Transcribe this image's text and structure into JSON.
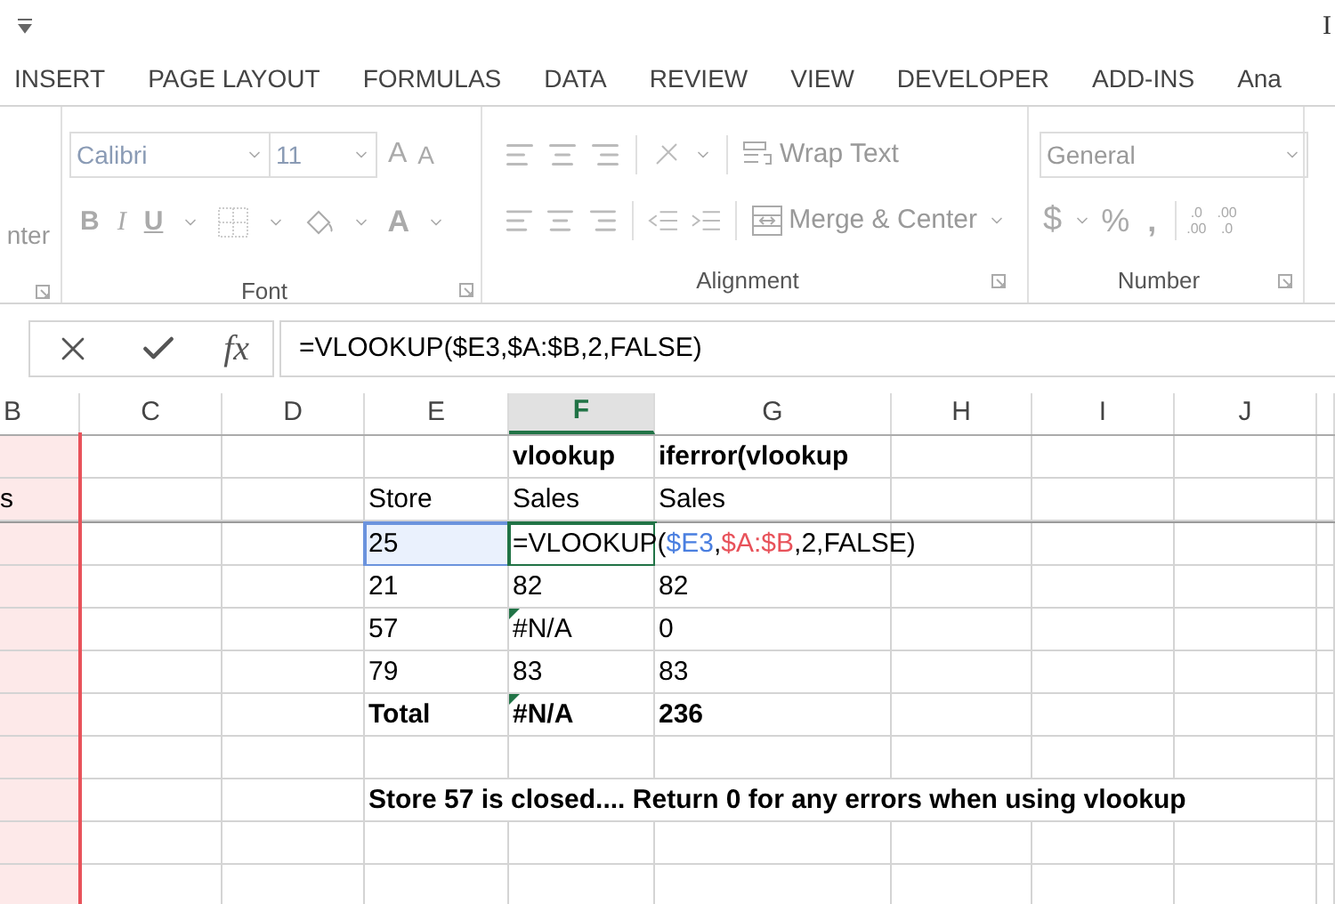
{
  "title_bar": {
    "title_fragment": "I"
  },
  "ribbon_tabs": [
    {
      "label": "INSERT",
      "selected": false
    },
    {
      "label": "PAGE LAYOUT",
      "selected": false
    },
    {
      "label": "FORMULAS",
      "selected": false
    },
    {
      "label": "DATA",
      "selected": false
    },
    {
      "label": "REVIEW",
      "selected": false
    },
    {
      "label": "VIEW",
      "selected": false
    },
    {
      "label": "DEVELOPER",
      "selected": false
    },
    {
      "label": "ADD-INS",
      "selected": false
    },
    {
      "label": "Ana",
      "selected": false
    }
  ],
  "ribbon": {
    "left_fragment": "nter",
    "font": {
      "name": "Calibri",
      "size": "11",
      "grow": "A",
      "shrink": "A",
      "bold": "B",
      "italic": "I",
      "underline": "U",
      "font_color": "A",
      "label": "Font"
    },
    "alignment": {
      "wrap_text": "Wrap Text",
      "merge_center": "Merge & Center",
      "label": "Alignment"
    },
    "number": {
      "format": "General",
      "currency": "$",
      "percent": "%",
      "comma": ",",
      "increase_decimal": [
        ".0",
        ".00"
      ],
      "decrease_decimal": [
        ".00",
        ".0"
      ],
      "label": "Number"
    }
  },
  "formula_bar": {
    "fx": "fx",
    "formula": "=VLOOKUP($E3,$A:$B,2,FALSE)"
  },
  "columns": [
    {
      "label": "B",
      "selected": false
    },
    {
      "label": "C",
      "selected": false
    },
    {
      "label": "D",
      "selected": false
    },
    {
      "label": "E",
      "selected": false
    },
    {
      "label": "F",
      "selected": true
    },
    {
      "label": "G",
      "selected": false
    },
    {
      "label": "H",
      "selected": false
    },
    {
      "label": "I",
      "selected": false
    },
    {
      "label": "J",
      "selected": false
    }
  ],
  "rows": [
    {
      "bold": true,
      "cells": {
        "f": {
          "text": "vlookup"
        },
        "g": {
          "text": "iferror(vlookup"
        }
      }
    },
    {
      "bold": false,
      "cells": {
        "b": {
          "text": "s"
        },
        "e": {
          "text": "Store"
        },
        "f": {
          "text": "Sales"
        },
        "g": {
          "text": "Sales"
        }
      }
    },
    {
      "bold": false,
      "cells": {
        "e": {
          "text": "25",
          "selected": true
        },
        "f": {
          "editing": true,
          "parts": [
            {
              "text": "=VLOOKUP(",
              "color": "#000000"
            },
            {
              "text": "$E3",
              "color": "#4a7fe0"
            },
            {
              "text": ",",
              "color": "#000000"
            },
            {
              "text": "$A:$B",
              "color": "#e8525a"
            },
            {
              "text": ",2,FALSE)",
              "color": "#000000"
            }
          ]
        }
      }
    },
    {
      "bold": false,
      "cells": {
        "e": {
          "text": "21"
        },
        "f": {
          "text": "82"
        },
        "g": {
          "text": "82"
        }
      }
    },
    {
      "bold": false,
      "cells": {
        "e": {
          "text": "57"
        },
        "f": {
          "text": "#N/A",
          "error": true
        },
        "g": {
          "text": "0"
        }
      }
    },
    {
      "bold": false,
      "cells": {
        "e": {
          "text": "79"
        },
        "f": {
          "text": "83"
        },
        "g": {
          "text": "83"
        }
      }
    },
    {
      "bold": true,
      "cells": {
        "e": {
          "text": "Total"
        },
        "f": {
          "text": "#N/A",
          "error": true
        },
        "g": {
          "text": "236"
        }
      }
    },
    {
      "cells": {}
    },
    {
      "bold": true,
      "cells": {
        "e": {
          "text": "Store 57 is closed.... Return 0 for any errors when using vlookup",
          "spill": true
        }
      }
    },
    {
      "cells": {}
    },
    {
      "cells": {}
    }
  ]
}
